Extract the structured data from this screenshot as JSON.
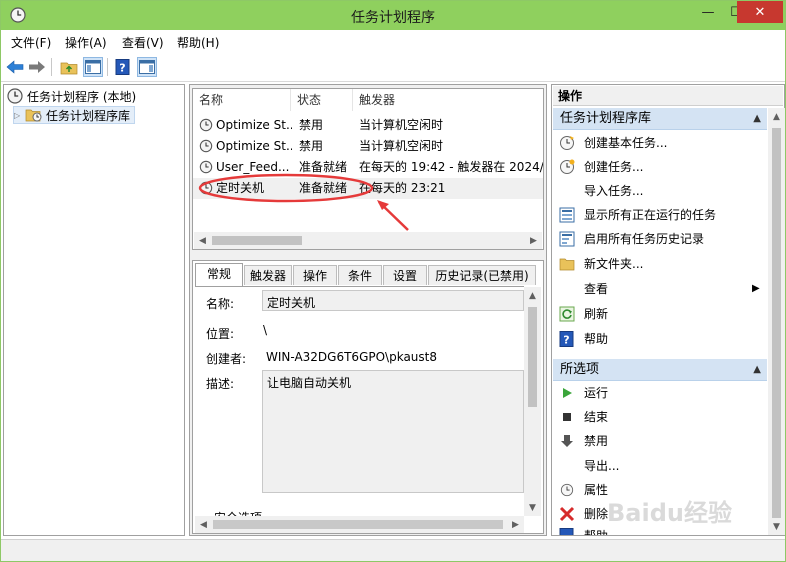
{
  "window": {
    "title": "任务计划程序",
    "accent_color": "#8fd05e",
    "caption_buttons": {
      "minimize": "—",
      "maximize": "☐",
      "close": "✕"
    }
  },
  "menu": [
    "文件(F)",
    "操作(A)",
    "查看(V)",
    "帮助(H)"
  ],
  "toolbar": {
    "icons": [
      "back-arrow-icon",
      "forward-arrow-icon",
      "up-folder-icon",
      "show-hide-tree-icon",
      "help-icon",
      "show-hide-action-pane-icon"
    ]
  },
  "tree": {
    "root": "任务计划程序 (本地)",
    "child": "任务计划程序库"
  },
  "task_list": {
    "columns": [
      "名称",
      "状态",
      "触发器"
    ],
    "rows": [
      {
        "name": "Optimize St...",
        "status": "禁用",
        "trigger": "当计算机空闲时"
      },
      {
        "name": "Optimize St...",
        "status": "禁用",
        "trigger": "当计算机空闲时"
      },
      {
        "name": "User_Feed...",
        "status": "准备就绪",
        "trigger": "在每天的 19:42 - 触发器在 2024/"
      },
      {
        "name": "定时关机",
        "status": "准备就绪",
        "trigger": "在每天的 23:21"
      }
    ],
    "highlight_color": "#e53a3a"
  },
  "details": {
    "tabs": [
      "常规",
      "触发器",
      "操作",
      "条件",
      "设置",
      "历史记录(已禁用)"
    ],
    "fields": {
      "name_label": "名称:",
      "name_value": "定时关机",
      "location_label": "位置:",
      "location_value": "\\",
      "author_label": "创建者:",
      "author_value": "WIN-A32DG6T6GPO\\pkaust8",
      "desc_label": "描述:",
      "desc_value": "让电脑自动关机",
      "security_label": "安全选项"
    }
  },
  "actions": {
    "title": "操作",
    "section1": {
      "title": "任务计划程序库",
      "items": [
        {
          "label": "创建基本任务...",
          "icon": "create-basic-task-icon"
        },
        {
          "label": "创建任务...",
          "icon": "create-task-icon"
        },
        {
          "label": "导入任务...",
          "icon": ""
        },
        {
          "label": "显示所有正在运行的任务",
          "icon": "running-tasks-icon"
        },
        {
          "label": "启用所有任务历史记录",
          "icon": "history-icon"
        },
        {
          "label": "新文件夹...",
          "icon": "folder-icon"
        },
        {
          "label": "查看",
          "icon": ""
        },
        {
          "label": "刷新",
          "icon": "refresh-icon"
        },
        {
          "label": "帮助",
          "icon": "help-icon"
        }
      ]
    },
    "section2": {
      "title": "所选项",
      "items": [
        {
          "label": "运行",
          "icon": "run-icon"
        },
        {
          "label": "结束",
          "icon": "stop-icon"
        },
        {
          "label": "禁用",
          "icon": "disable-icon"
        },
        {
          "label": "导出...",
          "icon": ""
        },
        {
          "label": "属性",
          "icon": "properties-icon"
        },
        {
          "label": "删除",
          "icon": "delete-icon"
        },
        {
          "label": "帮助",
          "icon": "help-icon"
        }
      ]
    }
  },
  "watermark": "Baidu经验"
}
